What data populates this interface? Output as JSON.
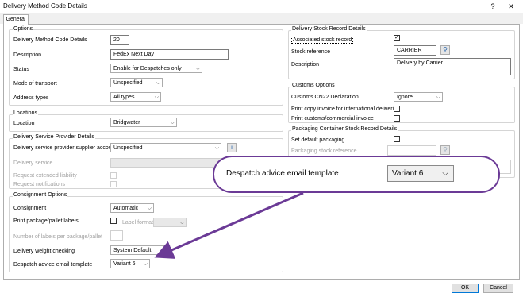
{
  "window": {
    "title": "Delivery Method Code Details",
    "help_glyph": "?",
    "close_glyph": "✕"
  },
  "tabs": [
    {
      "label": "General"
    }
  ],
  "options": {
    "group_title": "Options",
    "method_code_label": "Delivery Method Code Details",
    "method_code_value": "20",
    "description_label": "Description",
    "description_value": "FedEx Next Day",
    "status_label": "Status",
    "status_value": "Enable for Despatches only",
    "mode_label": "Mode of transport",
    "mode_value": "Unspecified",
    "address_label": "Address types",
    "address_value": "All types"
  },
  "locations": {
    "group_title": "Locations",
    "location_label": "Location",
    "location_value": "Bridgwater"
  },
  "service_provider": {
    "group_title": "Delivery Service Provider Details",
    "supplier_label": "Delivery service provider supplier account",
    "supplier_value": "Unspecified",
    "info_glyph": "i",
    "service_label": "Delivery service",
    "liability_label": "Request extended liability",
    "notifications_label": "Request notifications"
  },
  "consignment": {
    "group_title": "Consignment Options",
    "consignment_label": "Consignment",
    "consignment_value": "Automatic",
    "print_labels_label": "Print package/pallet labels",
    "label_format_label": "Label format",
    "num_labels_label": "Number of labels per package/pallet",
    "weight_label": "Delivery weight checking",
    "weight_value": "System Default",
    "email_template_label": "Despatch advice email template",
    "email_template_value": "Variant 6"
  },
  "stock_record": {
    "group_title": "Delivery Stock Record Details",
    "associated_label": "Associated stock record",
    "associated_checked": true,
    "stock_ref_label": "Stock reference",
    "stock_ref_value": "CARRIER",
    "description_label": "Description",
    "description_value": "Delivery by Carrier"
  },
  "customs": {
    "group_title": "Customs Options",
    "cn22_label": "Customs CN22 Declaration",
    "cn22_value": "Ignore",
    "print_copy_label": "Print copy invoice for international deliveries",
    "print_customs_label": "Print customs/commercial invoice"
  },
  "packaging": {
    "group_title": "Packaging Container Stock Record Details",
    "set_default_label": "Set default packaging",
    "packaging_ref_label": "Packaging stock reference"
  },
  "callout": {
    "label": "Despatch advice email template",
    "value": "Variant 6",
    "colors": {
      "border": "#6b3a96",
      "arrow": "#6b3a96"
    }
  },
  "footer": {
    "ok_label": "OK",
    "cancel_label": "Cancel"
  },
  "glyphs": {
    "check": "✓",
    "arrow_down": "⌵",
    "search": "⚲"
  }
}
